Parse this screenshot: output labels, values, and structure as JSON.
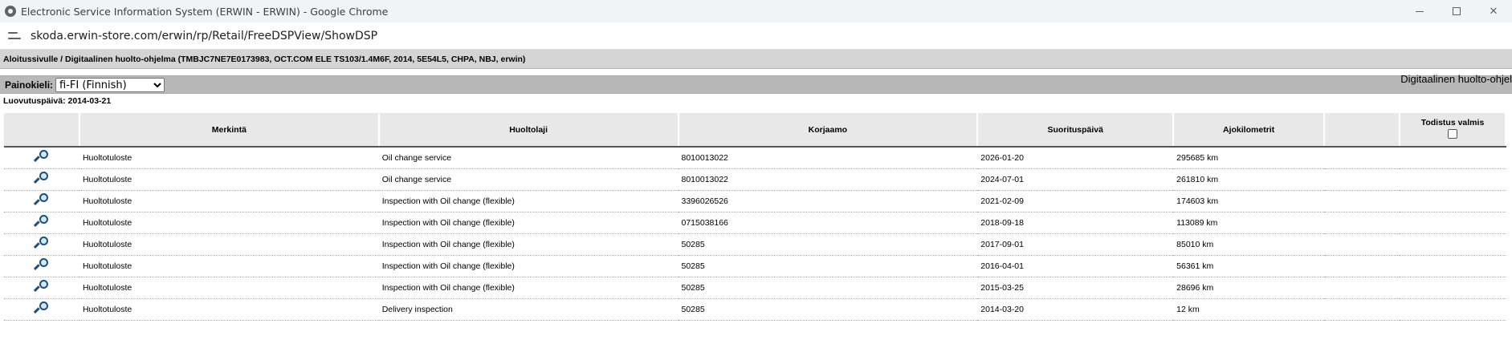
{
  "window": {
    "title": "Electronic Service Information System (ERWIN - ERWIN) - Google Chrome",
    "url": "skoda.erwin-store.com/erwin/rp/Retail/FreeDSPView/ShowDSP"
  },
  "breadcrumb": "Aloitussivulle / Digitaalinen huolto-ohjelma (TMBJC7NE7E0173983, OCT.COM ELE TS103/1.4M6F, 2014, 5E54L5, CHPA, NBJ, erwin)",
  "language": {
    "label": "Painokieli:",
    "selected": "fi-FI (Finnish)"
  },
  "page_title_right": "Digitaalinen huolto-ohjel",
  "release_date": "Luovutuspäivä: 2014-03-21",
  "table": {
    "headers": {
      "icon": "",
      "marking": "Merkintä",
      "service_type": "Huoltolaji",
      "workshop": "Korjaamo",
      "date": "Suorituspäivä",
      "mileage": "Ajokilometrit",
      "extra": "",
      "certificate": "Todistus valmis"
    },
    "rows": [
      {
        "marking": "Huoltotuloste",
        "service_type": "Oil change service",
        "workshop": "8010013022",
        "date": "2026-01-20",
        "mileage": "295685 km"
      },
      {
        "marking": "Huoltotuloste",
        "service_type": "Oil change service",
        "workshop": "8010013022",
        "date": "2024-07-01",
        "mileage": "261810 km"
      },
      {
        "marking": "Huoltotuloste",
        "service_type": "Inspection with Oil change (flexible)",
        "workshop": "3396026526",
        "date": "2021-02-09",
        "mileage": "174603 km"
      },
      {
        "marking": "Huoltotuloste",
        "service_type": "Inspection with Oil change (flexible)",
        "workshop": "0715038166",
        "date": "2018-09-18",
        "mileage": "113089 km"
      },
      {
        "marking": "Huoltotuloste",
        "service_type": "Inspection with Oil change (flexible)",
        "workshop": "50285",
        "date": "2017-09-01",
        "mileage": "85010 km"
      },
      {
        "marking": "Huoltotuloste",
        "service_type": "Inspection with Oil change (flexible)",
        "workshop": "50285",
        "date": "2016-04-01",
        "mileage": "56361 km"
      },
      {
        "marking": "Huoltotuloste",
        "service_type": "Inspection with Oil change (flexible)",
        "workshop": "50285",
        "date": "2015-03-25",
        "mileage": "28696 km"
      },
      {
        "marking": "Huoltotuloste",
        "service_type": "Delivery inspection",
        "workshop": "50285",
        "date": "2014-03-20",
        "mileage": "12 km"
      }
    ]
  }
}
